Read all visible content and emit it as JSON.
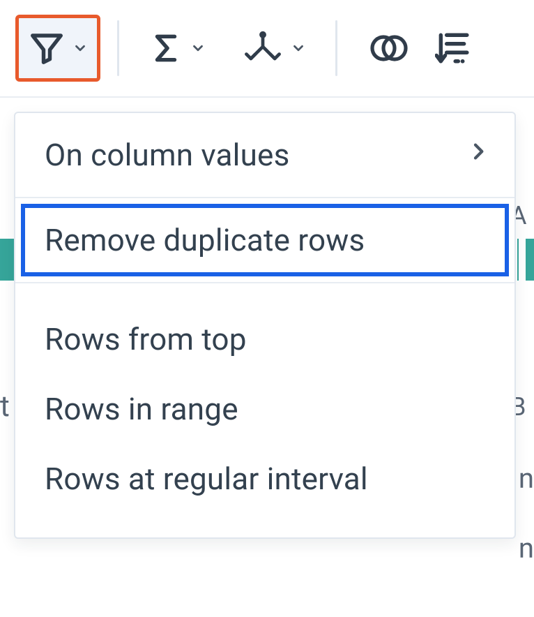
{
  "toolbar": {
    "filter_button": "Filter rows",
    "sum_button": "Aggregate",
    "pivot_button": "Pivot / Unpivot",
    "join_button": "Join",
    "sort_button": "Sort / Columns"
  },
  "menu": {
    "on_column_values": "On column values",
    "remove_duplicate_rows": "Remove duplicate rows",
    "rows_from_top": "Rows from top",
    "rows_in_range": "Rows in range",
    "rows_at_regular_interval": "Rows at regular interval"
  },
  "background": {
    "col_a": "A",
    "col_b": "B",
    "left_t": "t",
    "debit_n1": "n",
    "debit_n2": "n"
  },
  "highlight": {
    "toolbar_active": "filter",
    "menu_selected": "remove_duplicate_rows"
  }
}
